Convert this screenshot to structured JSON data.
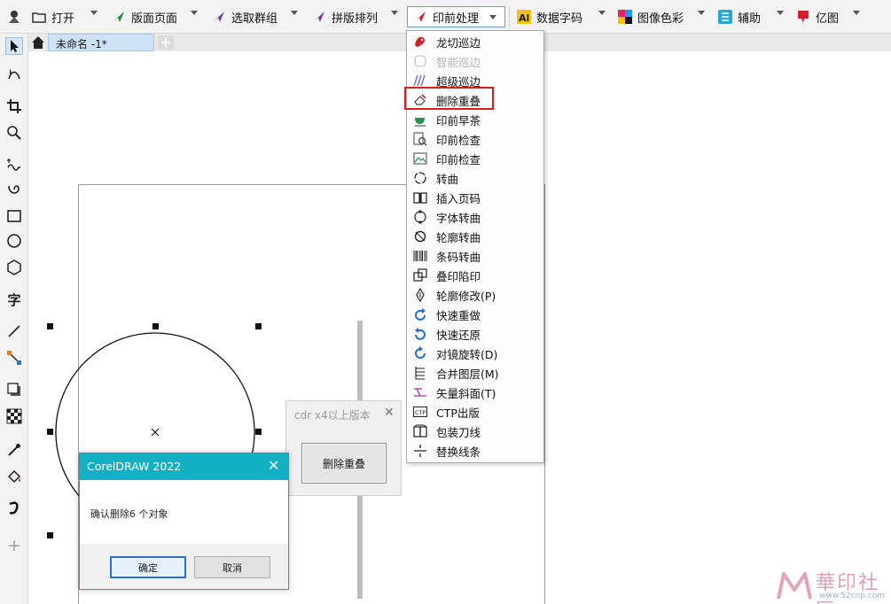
{
  "toolbar": {
    "items": [
      {
        "label": "打开",
        "icon": "folder-icon"
      },
      {
        "label": "版面页面",
        "icon": "green-plane-icon"
      },
      {
        "label": "选取群组",
        "icon": "purple-plane-icon"
      },
      {
        "label": "拼版排列",
        "icon": "purple-plane-icon"
      },
      {
        "label": "印前处理",
        "icon": "red-plane-icon"
      },
      {
        "label": "数据字码",
        "icon": "ai-icon"
      },
      {
        "label": "图像色彩",
        "icon": "color-squares-icon"
      },
      {
        "label": "辅助",
        "icon": "grid-icon"
      },
      {
        "label": "亿图",
        "icon": "red-flag-icon"
      }
    ]
  },
  "tabs": {
    "doc_title": "未命名 -1*",
    "add_label": "+"
  },
  "menu": {
    "items": [
      {
        "label": "龙切巡边",
        "icon": "dragon-icon",
        "disabled": false
      },
      {
        "label": "智能巡边",
        "icon": "shape-outline-icon",
        "disabled": true
      },
      {
        "label": "超级巡边",
        "icon": "wave-icon",
        "disabled": false
      },
      {
        "label": "删除重叠",
        "icon": "eraser-icon",
        "disabled": false
      },
      {
        "label": "印前早茶",
        "icon": "tea-cup-icon",
        "disabled": false
      },
      {
        "label": "印前检查",
        "icon": "magnifier-doc-icon",
        "disabled": false
      },
      {
        "label": "印前检查",
        "icon": "image-check-icon",
        "disabled": false
      },
      {
        "label": "转曲",
        "icon": "curve-circle-icon",
        "disabled": false
      },
      {
        "label": "插入页码",
        "icon": "book-icon",
        "disabled": false
      },
      {
        "label": "字体转曲",
        "icon": "dotted-circle-icon",
        "disabled": false
      },
      {
        "label": "轮廓转曲",
        "icon": "outline-curve-icon",
        "disabled": false
      },
      {
        "label": "条码转曲",
        "icon": "barcode-icon",
        "disabled": false
      },
      {
        "label": "叠印陷印",
        "icon": "overlap-squares-icon",
        "disabled": false
      },
      {
        "label": "轮廓修改(P)",
        "icon": "pen-nib-icon",
        "disabled": false
      },
      {
        "label": "快速重做",
        "icon": "redo-icon",
        "disabled": false
      },
      {
        "label": "快速还原",
        "icon": "undo-icon",
        "disabled": false
      },
      {
        "label": "对镜旋转(D)",
        "icon": "rotate-icon",
        "disabled": false
      },
      {
        "label": "合并图层(M)",
        "icon": "layers-icon",
        "disabled": false
      },
      {
        "label": "矢量斜面(T)",
        "icon": "bevel-icon",
        "disabled": false
      },
      {
        "label": "CTP出版",
        "icon": "ctp-icon",
        "disabled": false
      },
      {
        "label": "包装刀线",
        "icon": "package-icon",
        "disabled": false
      },
      {
        "label": "替换线条",
        "icon": "split-line-icon",
        "disabled": false
      }
    ],
    "highlight_color": "#d21f1f"
  },
  "mini_dialog": {
    "title": "cdr x4以上版本",
    "close": "✕",
    "button": "删除重叠"
  },
  "dialog": {
    "title": "CorelDRAW 2022",
    "close": "✕",
    "message": "确认删除6 个对象",
    "ok": "确定",
    "cancel": "取消",
    "title_color": "#12b0c2"
  },
  "watermark": {
    "text": "華印社區",
    "url": "www.52cnp.com"
  },
  "colors": {
    "accent": "#6c9bd2"
  }
}
